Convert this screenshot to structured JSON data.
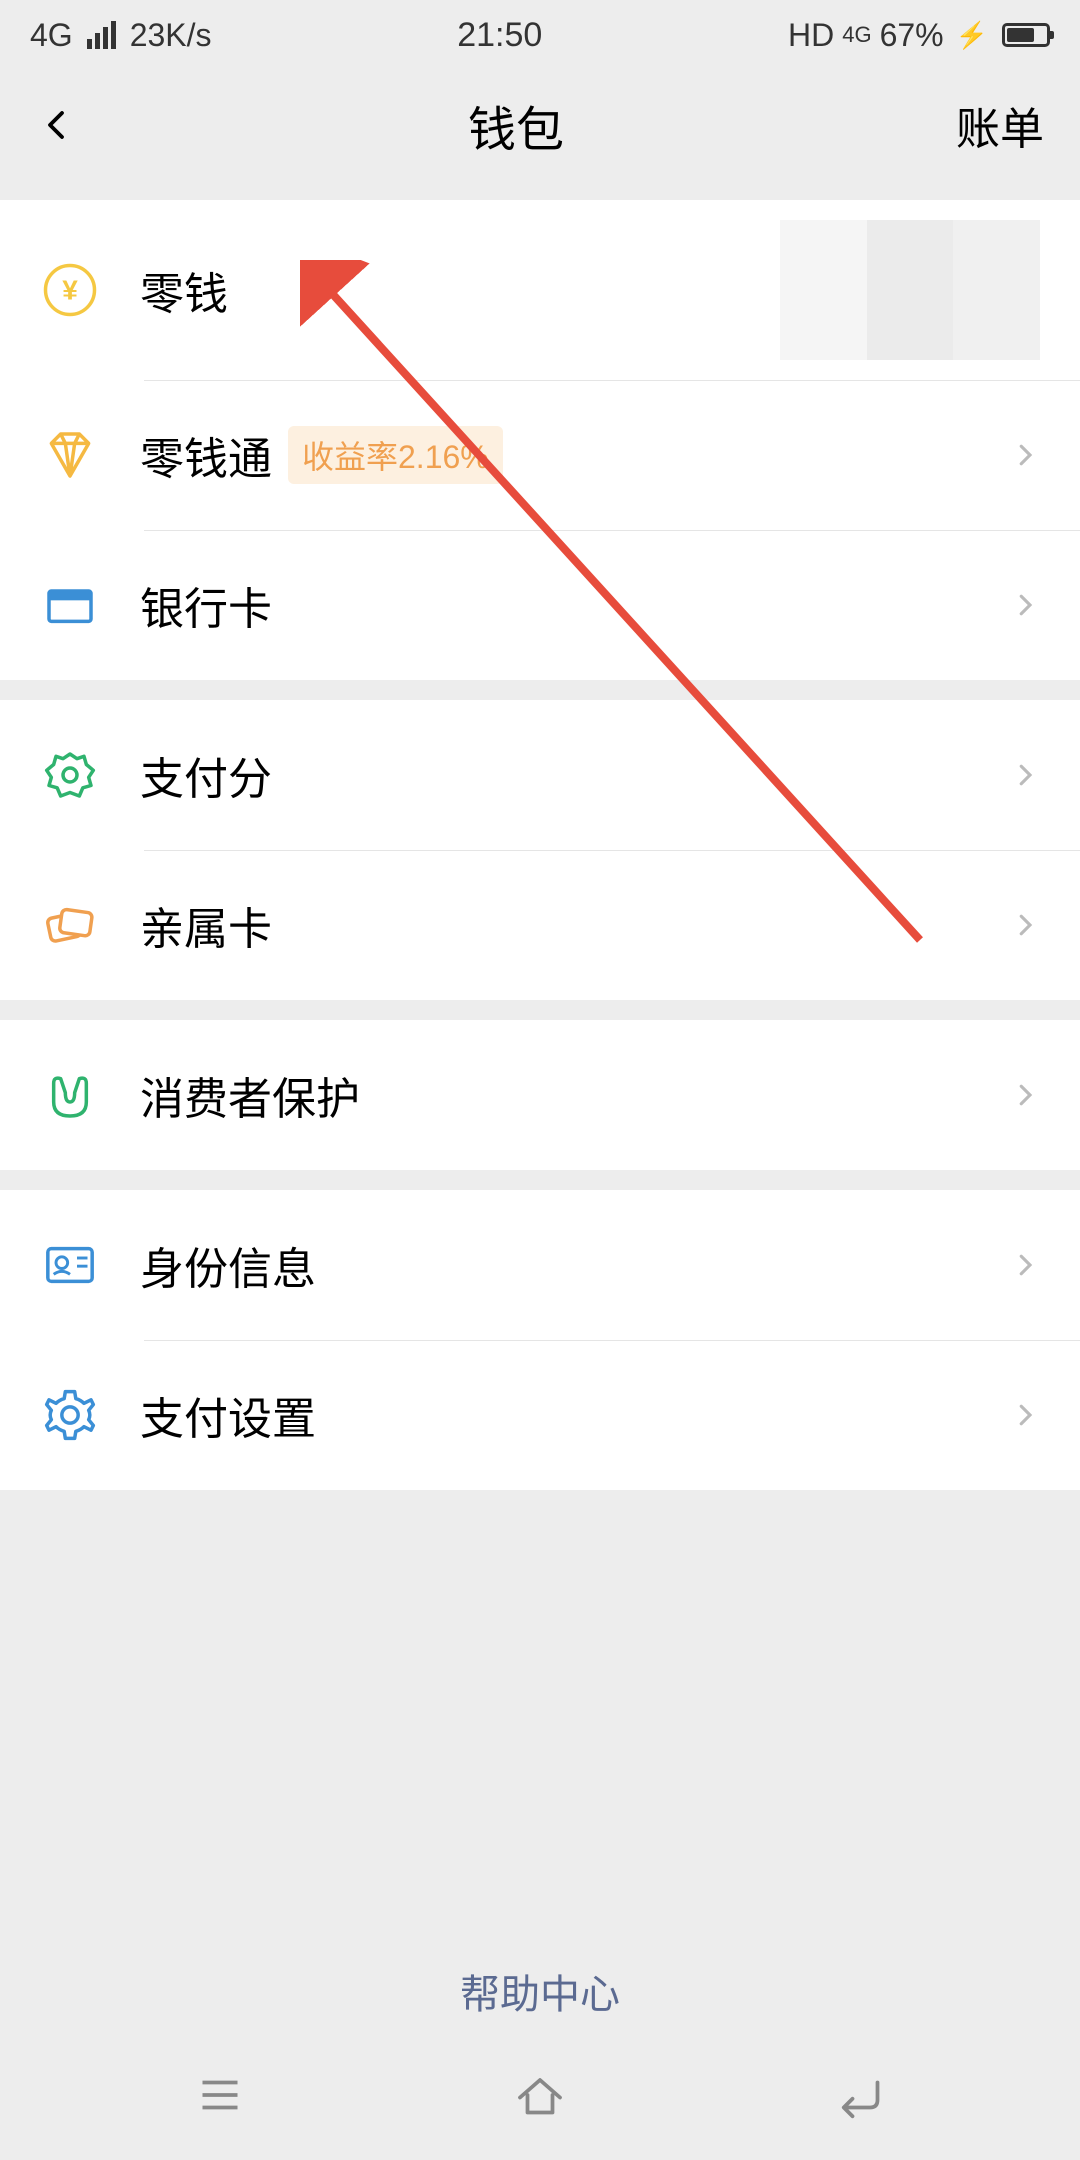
{
  "status": {
    "network": "4G",
    "speed": "23K/s",
    "time": "21:50",
    "hd": "HD",
    "data_icon": "4G",
    "battery_pct": "67%"
  },
  "nav": {
    "title": "钱包",
    "action": "账单"
  },
  "sections": [
    {
      "items": [
        {
          "id": "balance",
          "label": "零钱",
          "icon": "yen-circle-icon",
          "color": "#f5c842",
          "chevron": false,
          "badge": null
        },
        {
          "id": "balance-plus",
          "label": "零钱通",
          "icon": "diamond-icon",
          "color": "#f5b942",
          "chevron": true,
          "badge": "收益率2.16%"
        },
        {
          "id": "bank-cards",
          "label": "银行卡",
          "icon": "card-icon",
          "color": "#3b8fd6",
          "chevron": true,
          "badge": null
        }
      ]
    },
    {
      "items": [
        {
          "id": "pay-score",
          "label": "支付分",
          "icon": "medal-icon",
          "color": "#2fb36e",
          "chevron": true,
          "badge": null
        },
        {
          "id": "family-card",
          "label": "亲属卡",
          "icon": "linked-card-icon",
          "color": "#f0a050",
          "chevron": true,
          "badge": null
        }
      ]
    },
    {
      "items": [
        {
          "id": "consumer-protect",
          "label": "消费者保护",
          "icon": "hands-icon",
          "color": "#2fb36e",
          "chevron": true,
          "badge": null
        }
      ]
    },
    {
      "items": [
        {
          "id": "identity",
          "label": "身份信息",
          "icon": "id-card-icon",
          "color": "#3b8fd6",
          "chevron": true,
          "badge": null
        },
        {
          "id": "pay-settings",
          "label": "支付设置",
          "icon": "gear-icon",
          "color": "#3b8fd6",
          "chevron": true,
          "badge": null
        }
      ]
    }
  ],
  "help": {
    "label": "帮助中心"
  },
  "annotation": {
    "type": "arrow",
    "color": "#e74c3c"
  }
}
